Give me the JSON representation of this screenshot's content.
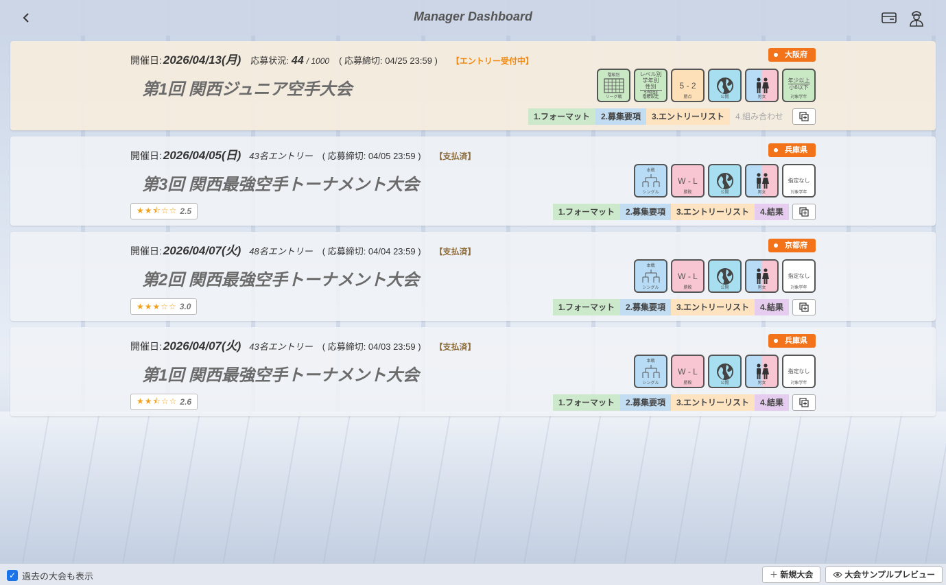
{
  "header": {
    "title": "Manager Dashboard"
  },
  "footer": {
    "past_label": "過去の大会も表示",
    "new_label": "新規大会",
    "preview_label": "大会サンプルプレビュー"
  },
  "labels": {
    "date_prefix": "開催日:",
    "status_prefix": "応募状況:",
    "format": "1.フォーマット",
    "requirements": "2.募集要項",
    "entry_list": "3.エントリーリスト",
    "matchups": "4.組み合わせ",
    "results": "4.結果"
  },
  "tournaments": [
    {
      "date": "2026/04/13(月)",
      "count": "44",
      "capacity": "/ 1000",
      "deadline": "( 応募締切: 04/25 23:59 )",
      "badge": "【エントリー受付中】",
      "name": "第1回 関西ジュニア空手大会",
      "prefecture": "大阪府",
      "tiles": {
        "t1_top": "階級別",
        "t1_bottom": "リーグ戦",
        "t2_lines": [
          "レベル別",
          "学年別",
          "性別",
          "2部制"
        ],
        "t2_bottom": "階級設定",
        "t3_main": "5 - 2",
        "t3_bottom": "勝点",
        "t4_bottom": "公開",
        "t5_bottom": "男女",
        "t6_lines": [
          "年少以上",
          "小6以下"
        ],
        "t6_bottom": "対象学年"
      }
    },
    {
      "date": "2026/04/05(日)",
      "entries": "43名エントリー",
      "deadline": "( 応募締切: 04/05 23:59 )",
      "badge": "【支払済】",
      "name": "第3回 関西最強空手トーナメント大会",
      "prefecture": "兵庫県",
      "rating": 2.5,
      "rating_text": "2.5",
      "stars": "★★⯪☆☆",
      "tiles": {
        "t1_top": "本戦",
        "t1_bottom": "シングル",
        "t2_main": "W - L",
        "t2_bottom": "勝敗",
        "t3_bottom": "公開",
        "t4_bottom": "男女",
        "t5_main": "指定なし",
        "t5_bottom": "対象学年"
      }
    },
    {
      "date": "2026/04/07(火)",
      "entries": "48名エントリー",
      "deadline": "( 応募締切: 04/04 23:59 )",
      "badge": "【支払済】",
      "name": "第2回 関西最強空手トーナメント大会",
      "prefecture": "京都府",
      "rating": 3.0,
      "rating_text": "3.0",
      "stars": "★★★☆☆",
      "tiles": {
        "t1_top": "本戦",
        "t1_bottom": "シングル",
        "t2_main": "W - L",
        "t2_bottom": "勝敗",
        "t3_bottom": "公開",
        "t4_bottom": "男女",
        "t5_main": "指定なし",
        "t5_bottom": "対象学年"
      }
    },
    {
      "date": "2026/04/07(火)",
      "entries": "43名エントリー",
      "deadline": "( 応募締切: 04/03 23:59 )",
      "badge": "【支払済】",
      "name": "第1回 関西最強空手トーナメント大会",
      "prefecture": "兵庫県",
      "rating": 2.6,
      "rating_text": "2.6",
      "stars": "★★⯪☆☆",
      "tiles": {
        "t1_top": "本戦",
        "t1_bottom": "シングル",
        "t2_main": "W - L",
        "t2_bottom": "勝敗",
        "t3_bottom": "公開",
        "t4_bottom": "男女",
        "t5_main": "指定なし",
        "t5_bottom": "対象学年"
      }
    }
  ],
  "colors": {
    "prefecture_badge": "#f2731a",
    "open_badge": "#f08a12",
    "checkbox": "#1a73e8",
    "star": "#f0a11e"
  },
  "icons": [
    "back-icon",
    "card-icon",
    "user-icon",
    "league-grid-icon",
    "bracket-icon",
    "globe-icon",
    "gender-icon",
    "copy-icon",
    "plus-icon",
    "eye-icon",
    "check-icon"
  ]
}
